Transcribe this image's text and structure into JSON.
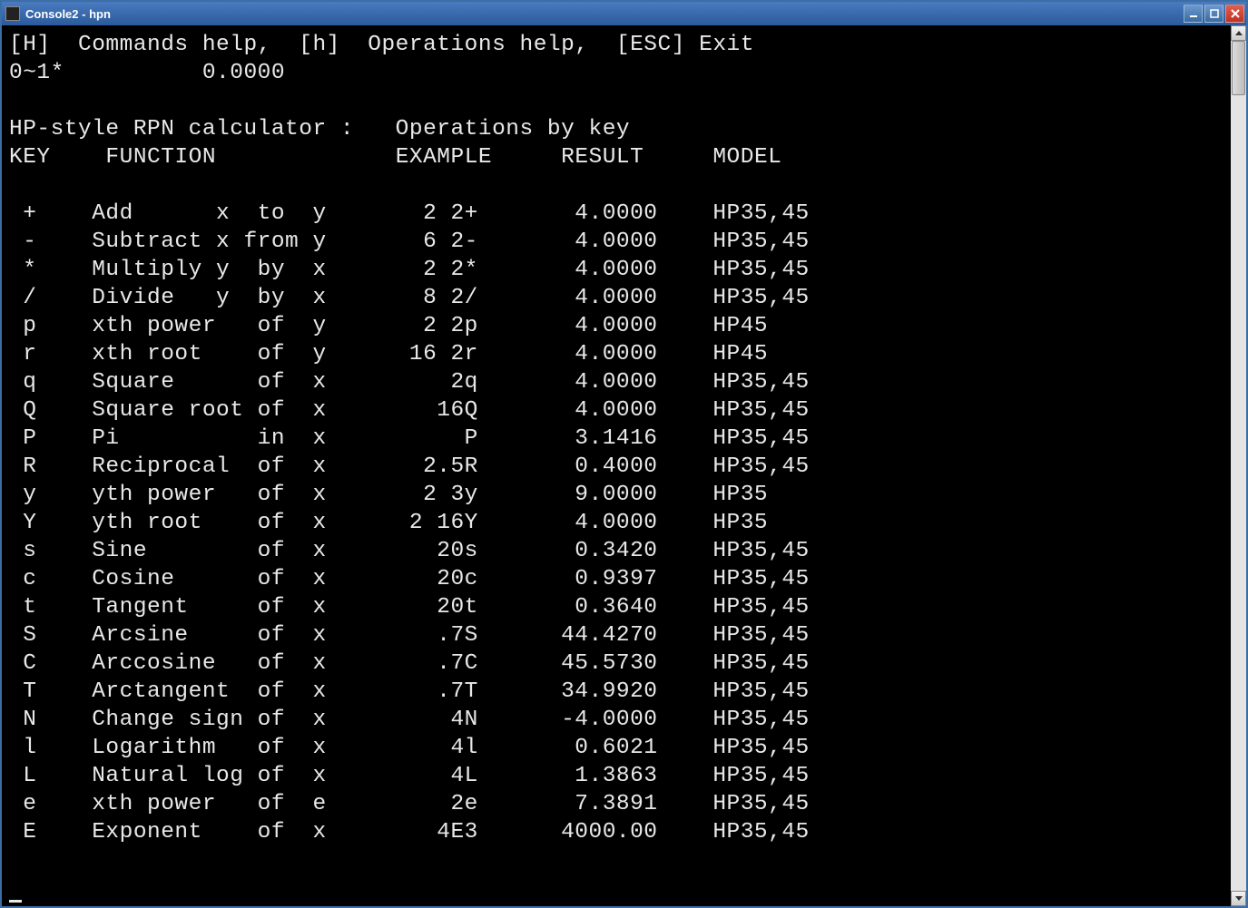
{
  "window": {
    "title": "Console2 - hpn"
  },
  "help_line": "[H]  Commands help,  [h]  Operations help,  [ESC] Exit",
  "stack_line": "0~1*          0.0000",
  "section_title": "HP-style RPN calculator :   Operations by key",
  "columns": {
    "key": "KEY",
    "function": "FUNCTION",
    "example": "EXAMPLE",
    "result": "RESULT",
    "model": "MODEL"
  },
  "ops": [
    {
      "key": "+",
      "func": "Add      x  to  y",
      "example": " 2 2+",
      "result": "  4.0000",
      "model": "HP35,45"
    },
    {
      "key": "-",
      "func": "Subtract x from y",
      "example": " 6 2-",
      "result": "  4.0000",
      "model": "HP35,45"
    },
    {
      "key": "*",
      "func": "Multiply y  by  x",
      "example": " 2 2*",
      "result": "  4.0000",
      "model": "HP35,45"
    },
    {
      "key": "/",
      "func": "Divide   y  by  x",
      "example": " 8 2/",
      "result": "  4.0000",
      "model": "HP35,45"
    },
    {
      "key": "p",
      "func": "xth power   of  y",
      "example": " 2 2p",
      "result": "  4.0000",
      "model": "HP45"
    },
    {
      "key": "r",
      "func": "xth root    of  y",
      "example": "16 2r",
      "result": "  4.0000",
      "model": "HP45"
    },
    {
      "key": "q",
      "func": "Square      of  x",
      "example": "  2q",
      "result": "  4.0000",
      "model": "HP35,45"
    },
    {
      "key": "Q",
      "func": "Square root of  x",
      "example": " 16Q",
      "result": "  4.0000",
      "model": "HP35,45"
    },
    {
      "key": "P",
      "func": "Pi          in  x",
      "example": "  P",
      "result": "  3.1416",
      "model": "HP35,45"
    },
    {
      "key": "R",
      "func": "Reciprocal  of  x",
      "example": "2.5R",
      "result": "  0.4000",
      "model": "HP35,45"
    },
    {
      "key": "y",
      "func": "yth power   of  x",
      "example": " 2 3y",
      "result": "  9.0000",
      "model": "HP35"
    },
    {
      "key": "Y",
      "func": "yth root    of  x",
      "example": " 2 16Y",
      "result": "  4.0000",
      "model": "HP35"
    },
    {
      "key": "s",
      "func": "Sine        of  x",
      "example": " 20s",
      "result": "  0.3420",
      "model": "HP35,45"
    },
    {
      "key": "c",
      "func": "Cosine      of  x",
      "example": " 20c",
      "result": "  0.9397",
      "model": "HP35,45"
    },
    {
      "key": "t",
      "func": "Tangent     of  x",
      "example": " 20t",
      "result": "  0.3640",
      "model": "HP35,45"
    },
    {
      "key": "S",
      "func": "Arcsine     of  x",
      "example": " .7S",
      "result": " 44.4270",
      "model": "HP35,45"
    },
    {
      "key": "C",
      "func": "Arccosine   of  x",
      "example": " .7C",
      "result": " 45.5730",
      "model": "HP35,45"
    },
    {
      "key": "T",
      "func": "Arctangent  of  x",
      "example": " .7T",
      "result": " 34.9920",
      "model": "HP35,45"
    },
    {
      "key": "N",
      "func": "Change sign of  x",
      "example": "  4N",
      "result": " -4.0000",
      "model": "HP35,45"
    },
    {
      "key": "l",
      "func": "Logarithm   of  x",
      "example": "  4l",
      "result": "  0.6021",
      "model": "HP35,45"
    },
    {
      "key": "L",
      "func": "Natural log of  x",
      "example": "  4L",
      "result": "  1.3863",
      "model": "HP35,45"
    },
    {
      "key": "e",
      "func": "xth power   of  e",
      "example": "  2e",
      "result": "  7.3891",
      "model": "HP35,45"
    },
    {
      "key": "E",
      "func": "Exponent    of  x",
      "example": " 4E3",
      "result": " 4000.00",
      "model": "HP35,45"
    }
  ]
}
